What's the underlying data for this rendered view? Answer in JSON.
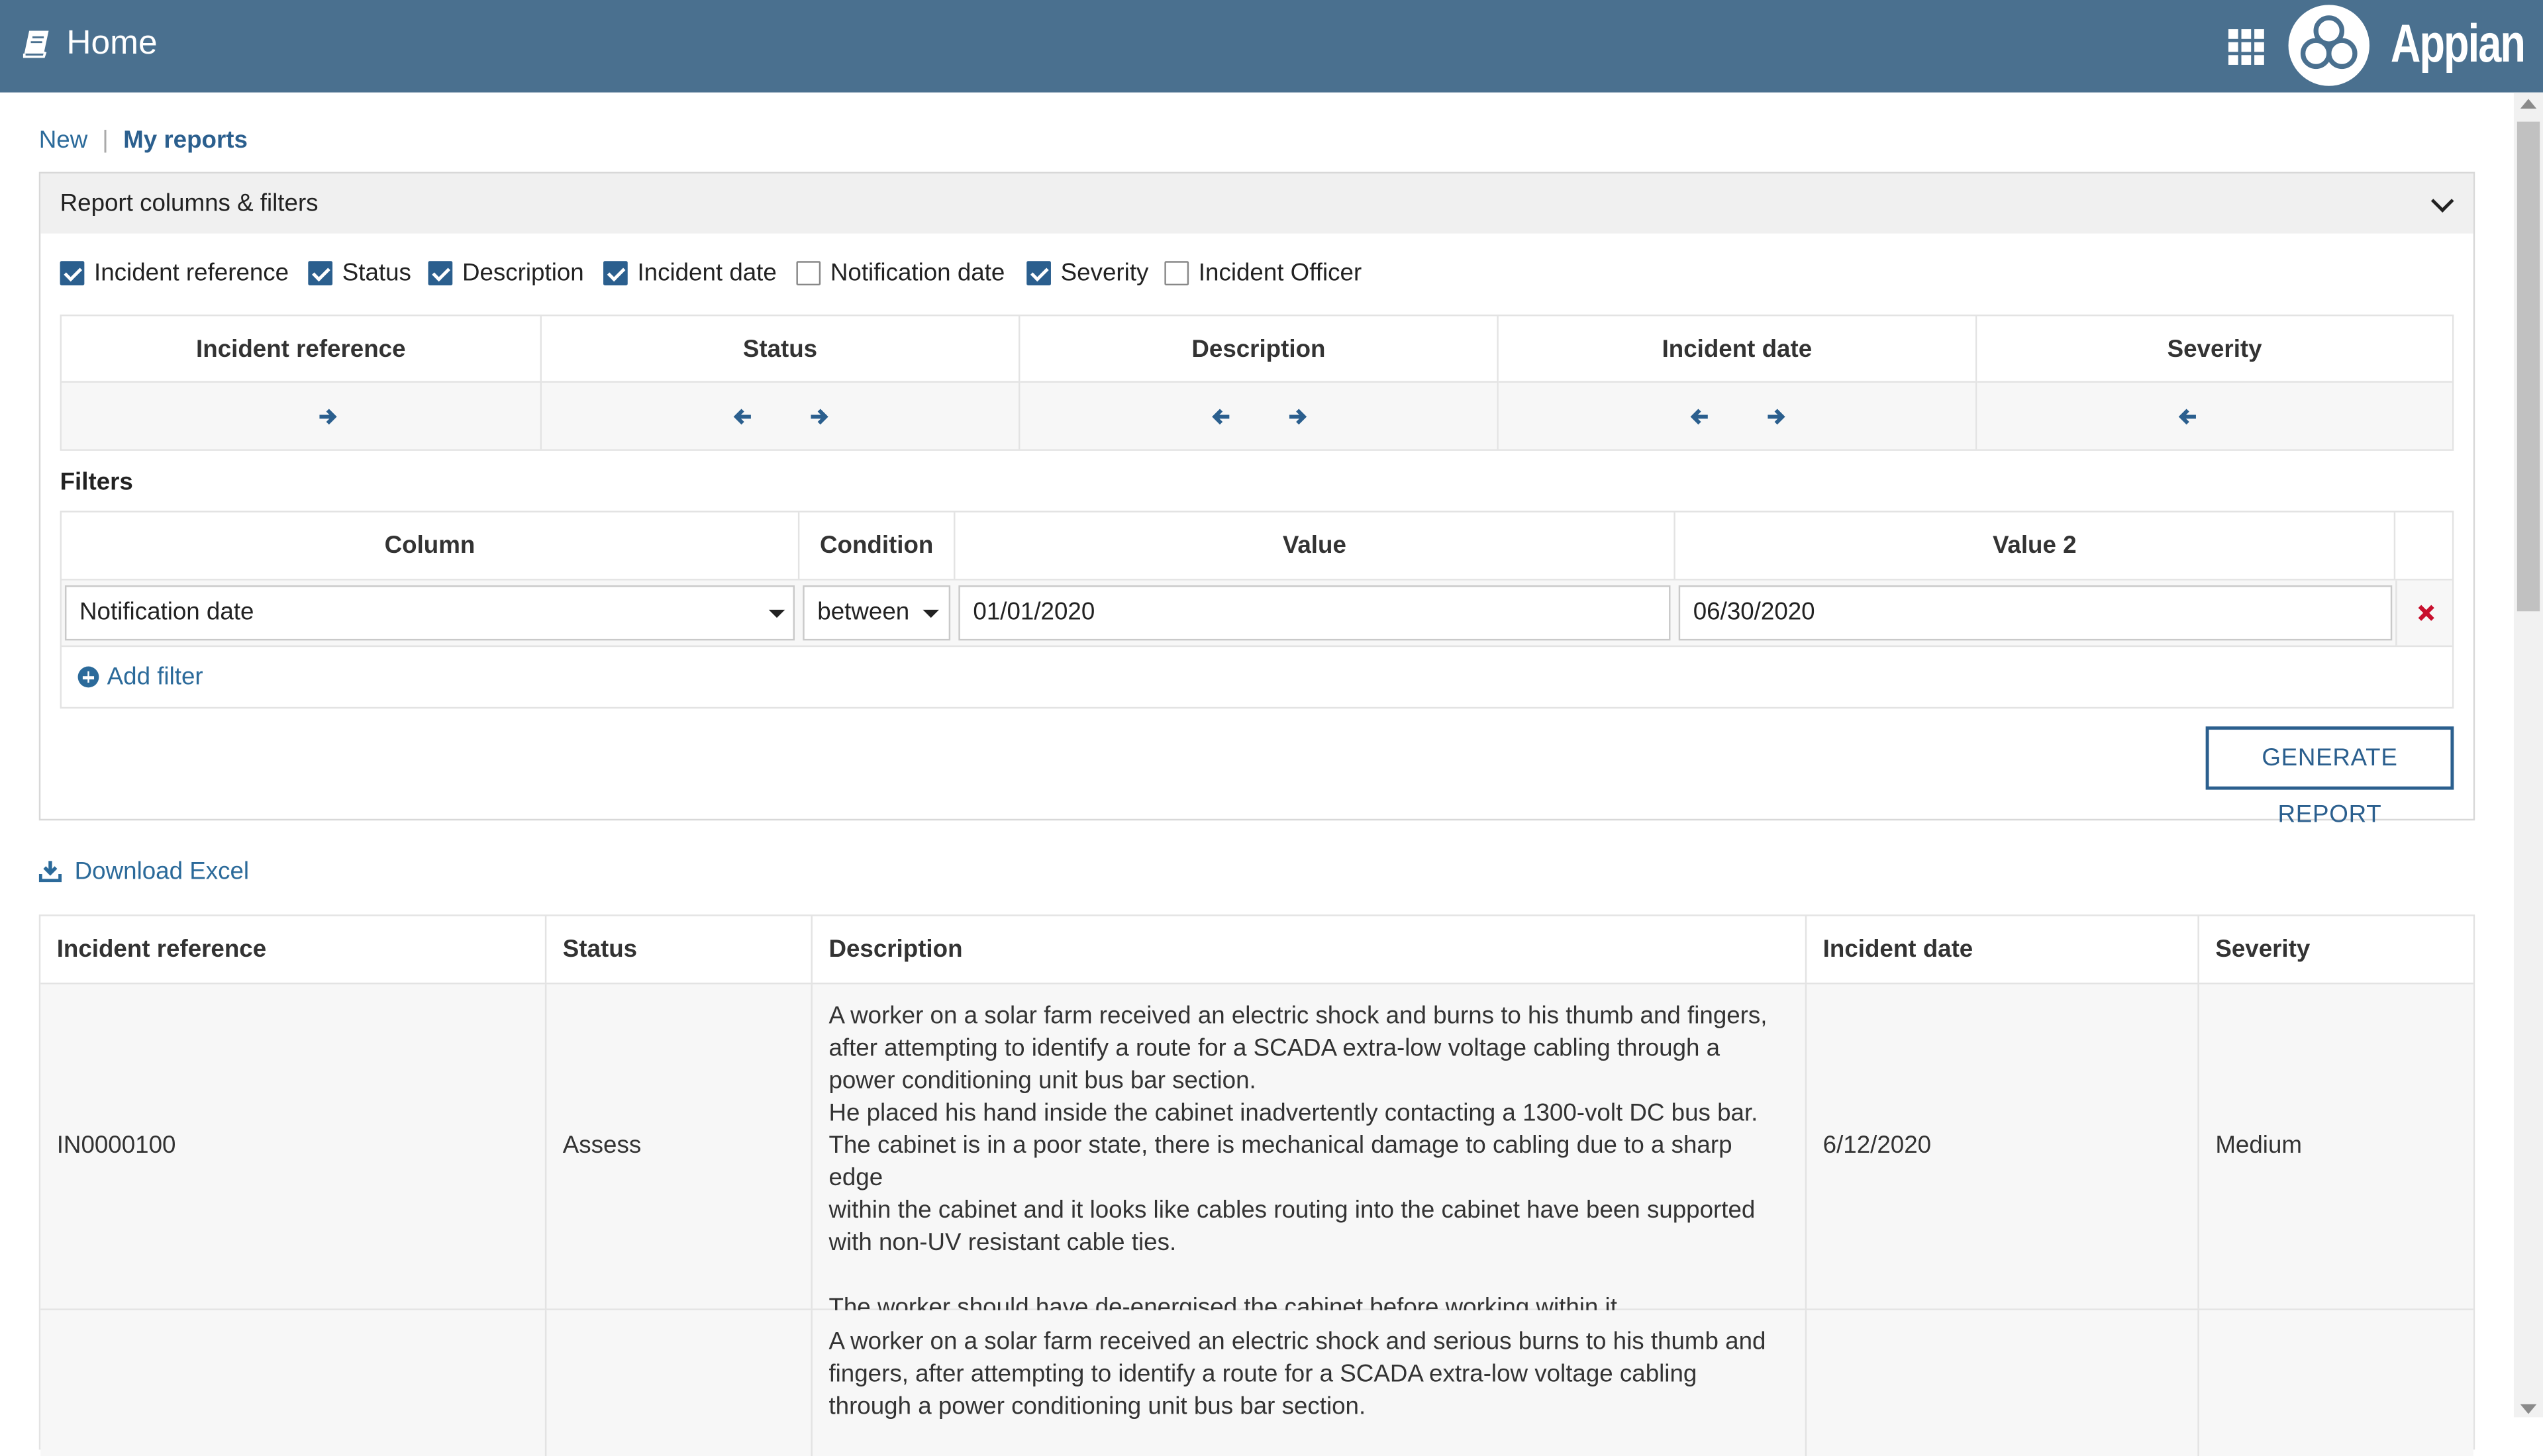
{
  "header": {
    "title": "Home",
    "brand": "Appian",
    "background": "#4a708f"
  },
  "nav": {
    "new_label": "New",
    "separator": "|",
    "my_reports_label": "My reports"
  },
  "panel": {
    "title": "Report columns & filters",
    "checkboxes": [
      {
        "label": "Incident reference",
        "checked": true
      },
      {
        "label": "Status",
        "checked": true
      },
      {
        "label": "Description",
        "checked": true
      },
      {
        "label": "Incident date",
        "checked": true
      },
      {
        "label": "Notification date",
        "checked": false
      },
      {
        "label": "Severity",
        "checked": true
      },
      {
        "label": "Incident Officer",
        "checked": false
      }
    ],
    "column_order": [
      "Incident reference",
      "Status",
      "Description",
      "Incident date",
      "Severity"
    ],
    "filters_title": "Filters",
    "filter_headers": [
      "Column",
      "Condition",
      "Value",
      "Value 2"
    ],
    "filter_row": {
      "column": "Notification date",
      "condition": "between",
      "value": "01/01/2020",
      "value2": "06/30/2020"
    },
    "add_filter_label": "Add filter",
    "generate_label": "GENERATE REPORT"
  },
  "download_label": "Download Excel",
  "results": {
    "headers": [
      "Incident reference",
      "Status",
      "Description",
      "Incident date",
      "Severity"
    ],
    "rows": [
      {
        "ref": "IN0000100",
        "status": "Assess",
        "desc_lines": [
          "A worker on a solar farm received an electric shock and burns to his thumb and fingers,",
          "after attempting to identify a route for a SCADA extra-low voltage cabling through a",
          "power conditioning unit bus bar section.",
          "He placed his hand inside the cabinet inadvertently contacting a 1300-volt DC bus bar.",
          "The cabinet is in a poor state, there is mechanical damage to cabling due to a sharp edge",
          "within the cabinet and it looks like cables routing into the cabinet have been supported",
          "with non-UV resistant cable ties.",
          "",
          "The worker should have de-energised the cabinet before working within it."
        ],
        "date": "6/12/2020",
        "severity": "Medium"
      },
      {
        "desc_lines": [
          "A worker on a solar farm received an electric shock and serious burns to his thumb and",
          "fingers, after attempting to identify a route for a SCADA extra-low voltage cabling",
          "through a power conditioning unit bus bar section."
        ]
      }
    ]
  },
  "colors": {
    "link": "#2b6a9a",
    "primary": "#2b5f8e",
    "delete": "#c8102e"
  }
}
